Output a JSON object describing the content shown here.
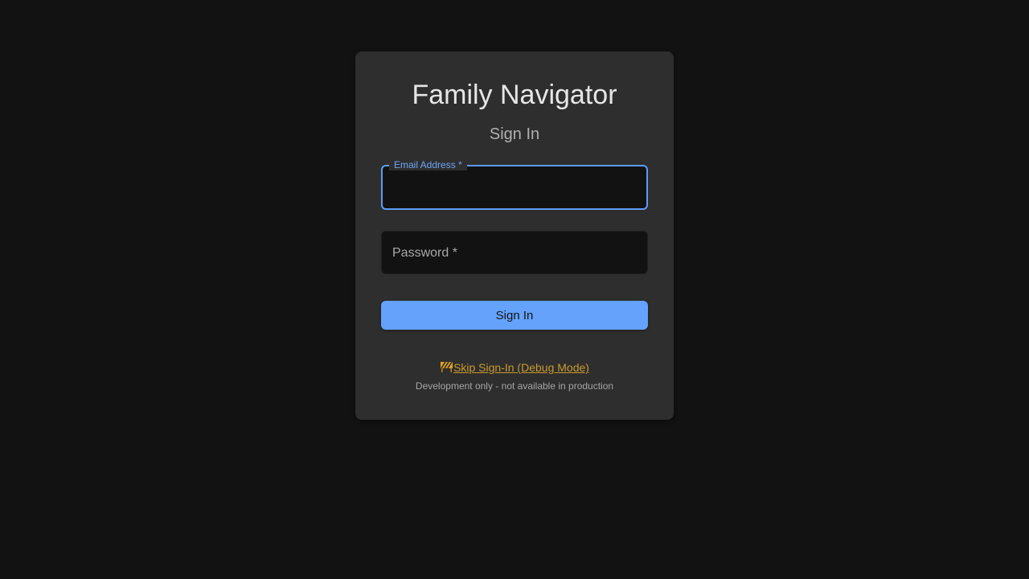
{
  "app": {
    "title": "Family Navigator"
  },
  "form": {
    "heading": "Sign In",
    "email": {
      "label": "Email Address",
      "required_mark": "*",
      "value": ""
    },
    "password": {
      "label": "Password",
      "required_mark": "*",
      "value": ""
    },
    "submit_label": "Sign In"
  },
  "debug": {
    "icon": "construction-barrier-icon",
    "link_label": "Skip Sign-In (Debug Mode)",
    "note": "Development only - not available in production"
  },
  "colors": {
    "background": "#121212",
    "card": "#2e2e2e",
    "accent": "#64a2fb",
    "debug_link": "#c99a2e"
  }
}
